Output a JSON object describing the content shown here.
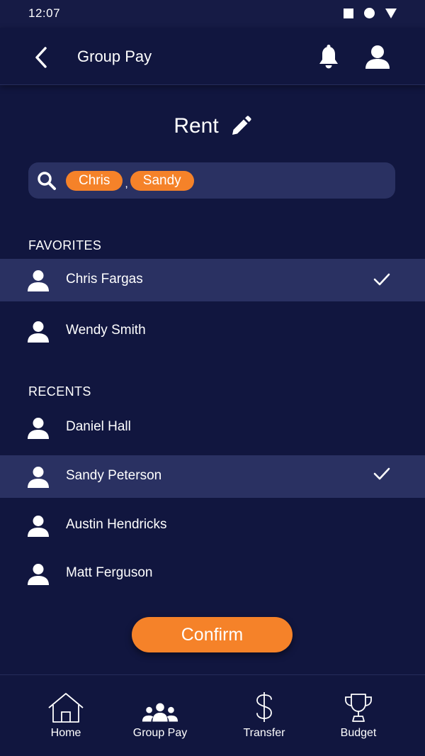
{
  "status_bar": {
    "time": "12:07"
  },
  "app_bar": {
    "title": "Group Pay"
  },
  "group": {
    "title": "Rent"
  },
  "search": {
    "chips": [
      "Chris",
      "Sandy"
    ],
    "separator": ","
  },
  "sections": {
    "favorites_label": "FAVORITES",
    "recents_label": "RECENTS"
  },
  "favorites": [
    {
      "name": "Chris Fargas",
      "selected": true
    },
    {
      "name": "Wendy Smith",
      "selected": false
    }
  ],
  "recents": [
    {
      "name": "Daniel Hall",
      "selected": false
    },
    {
      "name": "Sandy Peterson",
      "selected": true
    },
    {
      "name": "Austin Hendricks",
      "selected": false
    },
    {
      "name": "Matt Ferguson",
      "selected": false
    }
  ],
  "confirm_label": "Confirm",
  "bottom_nav": {
    "home": "Home",
    "group_pay": "Group Pay",
    "transfer": "Transfer",
    "budget": "Budget"
  },
  "colors": {
    "background": "#11163f",
    "selected_row": "#2a3162",
    "accent": "#f58229"
  }
}
